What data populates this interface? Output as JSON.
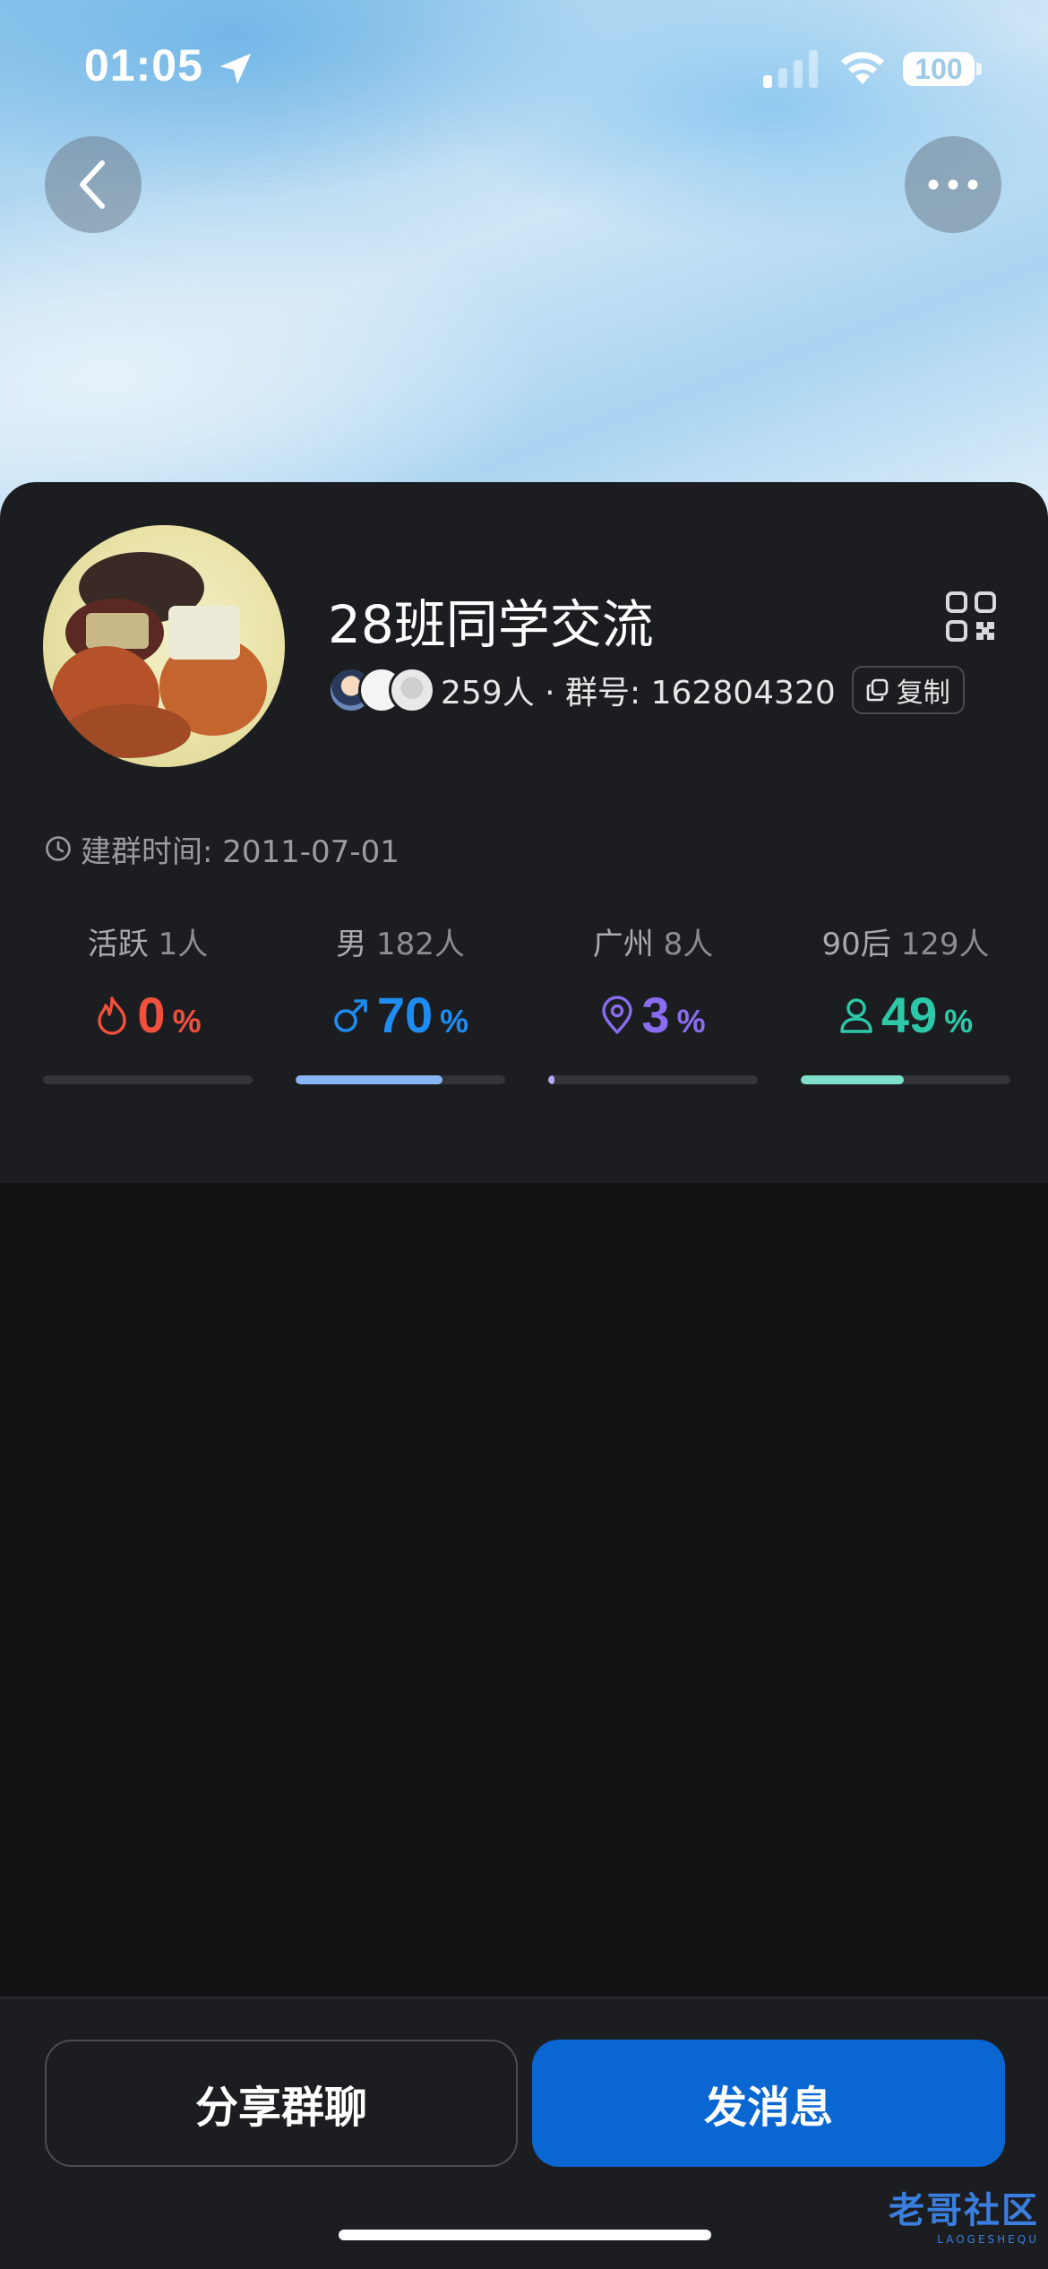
{
  "status_bar": {
    "time": "01:05",
    "battery": "100"
  },
  "header": {
    "back_icon": "chevron-left-icon",
    "more_icon": "ellipsis-icon"
  },
  "group": {
    "name": "28班同学交流",
    "members_text": "259人 · 群号: 162804320",
    "copy_label": "复制",
    "created_text": "建群时间: 2011-07-01"
  },
  "stats": [
    {
      "label": "活跃",
      "count": "1人",
      "value": "0",
      "unit": "%",
      "icon": "flame-icon",
      "color": "#f0503c",
      "fill": 0.0
    },
    {
      "label": "男",
      "count": "182人",
      "value": "70",
      "unit": "%",
      "icon": "male-icon",
      "color": "#1e8cf0",
      "fill": 0.7
    },
    {
      "label": "广州",
      "count": "8人",
      "value": "3",
      "unit": "%",
      "icon": "location-pin-icon",
      "color": "#8a6cf0",
      "fill": 0.03
    },
    {
      "label": "90后",
      "count": "129人",
      "value": "49",
      "unit": "%",
      "icon": "person-icon",
      "color": "#2cc8a8",
      "fill": 0.49
    }
  ],
  "stat_bar_colors": [
    "#33353a",
    "#8ab6f4",
    "#b9a8f4",
    "#7ee0c8"
  ],
  "actions": {
    "share_label": "分享群聊",
    "send_label": "发消息"
  },
  "watermark": {
    "main": "老哥社区",
    "sub": "LAOGESHEQU"
  }
}
